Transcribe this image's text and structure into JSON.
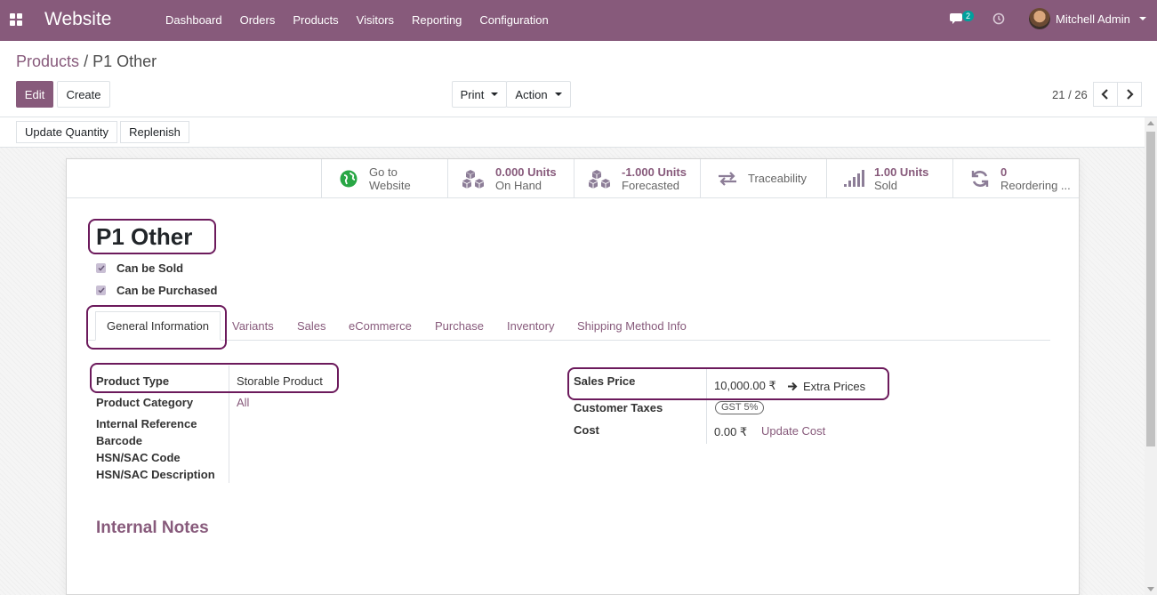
{
  "navbar": {
    "brand": "Website",
    "menu": [
      "Dashboard",
      "Orders",
      "Products",
      "Visitors",
      "Reporting",
      "Configuration"
    ],
    "chat_badge": "2",
    "user_name": "Mitchell Admin"
  },
  "breadcrumb": {
    "parent": "Products",
    "separator": "/",
    "current": "P1 Other"
  },
  "control_panel": {
    "edit_label": "Edit",
    "create_label": "Create",
    "print_label": "Print",
    "action_label": "Action",
    "pager": "21 / 26"
  },
  "statusbar": {
    "update_quantity_label": "Update Quantity",
    "replenish_label": "Replenish"
  },
  "smart_buttons": {
    "website": {
      "line1": "Go to",
      "line2": "Website"
    },
    "on_hand": {
      "value": "0.000 Units",
      "label": "On Hand"
    },
    "forecasted": {
      "value": "-1.000 Units",
      "label": "Forecasted"
    },
    "traceability": {
      "label": "Traceability"
    },
    "sold": {
      "value": "1.00 Units",
      "label": "Sold"
    },
    "reordering": {
      "value": "0",
      "label": "Reordering ..."
    }
  },
  "product": {
    "name": "P1 Other",
    "can_be_sold_label": "Can be Sold",
    "can_be_sold": true,
    "can_be_purchased_label": "Can be Purchased",
    "can_be_purchased": true
  },
  "tabs": [
    "General Information",
    "Variants",
    "Sales",
    "eCommerce",
    "Purchase",
    "Inventory",
    "Shipping Method Info"
  ],
  "general": {
    "left_labels": {
      "product_type": "Product Type",
      "product_category": "Product Category",
      "internal_reference": "Internal Reference",
      "barcode": "Barcode",
      "hsn_code": "HSN/SAC Code",
      "hsn_description": "HSN/SAC Description"
    },
    "product_type_value": "Storable Product",
    "product_category_value": "All",
    "right_labels": {
      "sales_price": "Sales Price",
      "customer_taxes": "Customer Taxes",
      "cost": "Cost"
    },
    "sales_price_value": "10,000.00 ₹",
    "extra_prices_label": "Extra Prices",
    "customer_tax_badge": "GST 5%",
    "cost_value": "0.00 ₹",
    "update_cost_label": "Update Cost",
    "internal_notes_title": "Internal Notes"
  },
  "colors": {
    "brand": "#875a7b",
    "highlight": "#6c1a5c",
    "website_icon": "#28a745"
  }
}
